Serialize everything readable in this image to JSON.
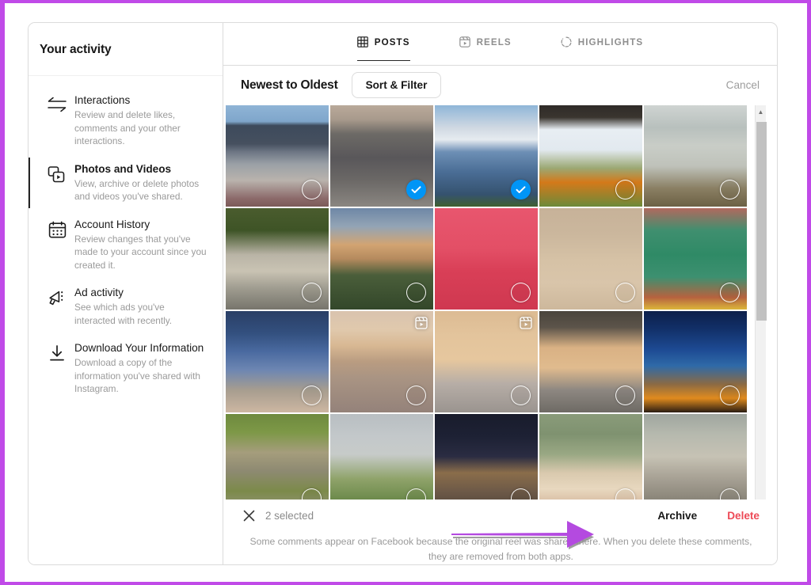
{
  "annotation": {
    "arrow_color": "#b44ae0",
    "shadow_color": "#8a8a8a",
    "points_to": "Archive"
  },
  "frame": {
    "border_color": "#c04ae8"
  },
  "sidebar": {
    "title": "Your activity",
    "items": [
      {
        "icon": "interactions-arrows-icon",
        "label": "Interactions",
        "desc": "Review and delete likes, comments and your other interactions.",
        "active": false
      },
      {
        "icon": "photos-videos-icon",
        "label": "Photos and Videos",
        "desc": "View, archive or delete photos and videos you've shared.",
        "active": true
      },
      {
        "icon": "calendar-icon",
        "label": "Account History",
        "desc": "Review changes that you've made to your account since you created it.",
        "active": false
      },
      {
        "icon": "megaphone-icon",
        "label": "Ad activity",
        "desc": "See which ads you've interacted with recently.",
        "active": false
      },
      {
        "icon": "download-icon",
        "label": "Download Your Information",
        "desc": "Download a copy of the information you've shared with Instagram.",
        "active": false
      }
    ]
  },
  "tabs": [
    {
      "icon": "grid-icon",
      "label": "POSTS",
      "active": true
    },
    {
      "icon": "reels-icon",
      "label": "REELS",
      "active": false
    },
    {
      "icon": "highlights-circle-icon",
      "label": "HIGHLIGHTS",
      "active": false
    }
  ],
  "toolbar": {
    "sort_label": "Newest to Oldest",
    "sort_filter_label": "Sort & Filter",
    "cancel_label": "Cancel"
  },
  "grid": {
    "columns": 5,
    "rows": 4,
    "items": [
      {
        "alt": "river-valley-mountains",
        "selected": false,
        "reel": false
      },
      {
        "alt": "gravel-road-desert",
        "selected": true,
        "reel": false
      },
      {
        "alt": "snow-mountain-lake-fence",
        "selected": true,
        "reel": false
      },
      {
        "alt": "orange-flower-snow",
        "selected": false,
        "reel": false
      },
      {
        "alt": "birds-lake-sunrise",
        "selected": false,
        "reel": false
      },
      {
        "alt": "red-phone-flowers-garden",
        "selected": false,
        "reel": false
      },
      {
        "alt": "sunset-clouds-house-trees",
        "selected": false,
        "reel": false
      },
      {
        "alt": "phones-on-pink-table",
        "selected": false,
        "reel": false
      },
      {
        "alt": "toy-figures-on-floor",
        "selected": false,
        "reel": false
      },
      {
        "alt": "succulent-plant-pots",
        "selected": false,
        "reel": false
      },
      {
        "alt": "tablet-app-icons-hand",
        "selected": false,
        "reel": false
      },
      {
        "alt": "beach-sunset-people",
        "selected": false,
        "reel": true
      },
      {
        "alt": "ginger-cat-sitting",
        "selected": false,
        "reel": true
      },
      {
        "alt": "ginger-cat-lying",
        "selected": false,
        "reel": false
      },
      {
        "alt": "airplane-wing-sunset",
        "selected": false,
        "reel": false
      },
      {
        "alt": "tabby-cat-and-kitten",
        "selected": false,
        "reel": false
      },
      {
        "alt": "rainbow-over-trees",
        "selected": false,
        "reel": false
      },
      {
        "alt": "classroom-decoration-house",
        "selected": false,
        "reel": false
      },
      {
        "alt": "hand-holding-daisy",
        "selected": false,
        "reel": false
      },
      {
        "alt": "rocky-river-shore",
        "selected": false,
        "reel": false
      }
    ]
  },
  "scrollbar": {
    "up_arrow": "scroll-up-arrow-icon"
  },
  "footer": {
    "close_icon": "close-x-icon",
    "selected_count": "2 selected",
    "archive_label": "Archive",
    "delete_label": "Delete",
    "note": "Some comments appear on Facebook because the original reel was shared there. When you delete these comments, they are removed from both apps."
  }
}
